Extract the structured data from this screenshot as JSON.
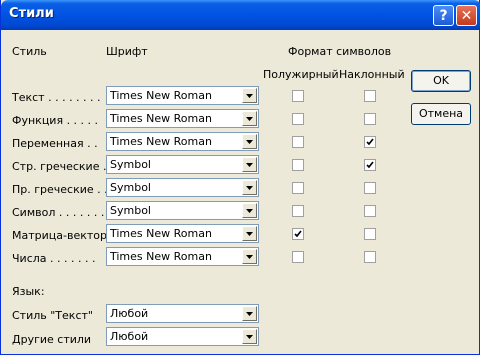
{
  "window": {
    "title": "Стили"
  },
  "titlebar": {
    "help_label": "?",
    "close_label": "✕"
  },
  "headers": {
    "style": "Стиль",
    "font": "Шрифт",
    "format": "Формат символов",
    "bold": "Полужирный",
    "italic": "Наклонный"
  },
  "rows": [
    {
      "label": "Текст . . . . . . . .",
      "font": "Times New Roman",
      "bold": false,
      "italic": false
    },
    {
      "label": "Функция  . . . . .",
      "font": "Times New Roman",
      "bold": false,
      "italic": false
    },
    {
      "label": "Переменная . .",
      "font": "Times New Roman",
      "bold": false,
      "italic": true
    },
    {
      "label": "Стр. греческие .",
      "font": "Symbol",
      "bold": false,
      "italic": true
    },
    {
      "label": "Пр. греческие . .",
      "font": "Symbol",
      "bold": false,
      "italic": false
    },
    {
      "label": "Символ . . . . . . .",
      "font": "Symbol",
      "bold": false,
      "italic": false
    },
    {
      "label": "Матрица-вектор",
      "font": "Times New Roman",
      "bold": true,
      "italic": false
    },
    {
      "label": "Числа . . . . . . .",
      "font": "Times New Roman",
      "bold": false,
      "italic": false
    }
  ],
  "language": {
    "heading": "Язык:",
    "text_style_label": "Стиль \"Текст\"",
    "text_style_value": "Любой",
    "other_styles_label": "Другие стили",
    "other_styles_value": "Любой"
  },
  "buttons": {
    "ok": "OK",
    "cancel": "Отмена"
  }
}
